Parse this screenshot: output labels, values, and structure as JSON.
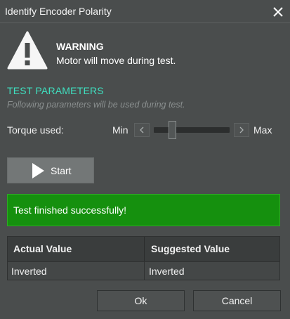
{
  "window": {
    "title": "Identify Encoder Polarity",
    "close_icon": "close-icon"
  },
  "warning": {
    "icon": "warning-icon",
    "title": "WARNING",
    "message": "Motor will move during test."
  },
  "test_parameters": {
    "title": "TEST PARAMETERS",
    "subtitle": "Following parameters will be used during test.",
    "torque_label": "Torque used:",
    "slider": {
      "min_label": "Min",
      "max_label": "Max",
      "value_fraction": 0.22
    }
  },
  "start_button": {
    "label": "Start",
    "icon": "play-icon"
  },
  "status": {
    "message": "Test finished successfully!",
    "color": "#15900e"
  },
  "results_table": {
    "columns": [
      "Actual Value",
      "Suggested Value"
    ],
    "rows": [
      [
        "Inverted",
        "Inverted"
      ]
    ]
  },
  "footer": {
    "ok_label": "Ok",
    "cancel_label": "Cancel"
  },
  "colors": {
    "background": "#4a4d4d",
    "accent": "#3fe0c0",
    "success": "#15900e"
  }
}
